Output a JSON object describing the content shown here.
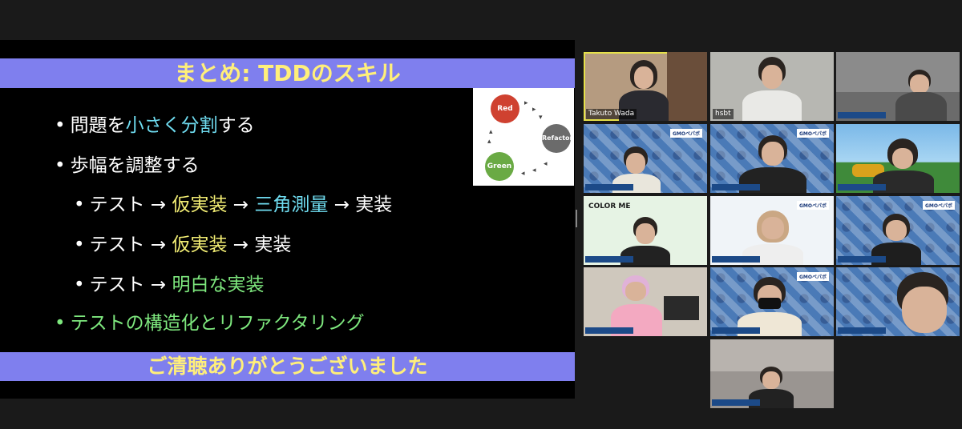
{
  "slide": {
    "title": "まとめ: TDDのスキル",
    "bullets": [
      {
        "parts": [
          "問題を",
          "小さく分割",
          "する"
        ]
      },
      {
        "parts": [
          "歩幅を調整する"
        ]
      },
      {
        "parts": [
          "テスト → ",
          "仮実装",
          " → ",
          "三角測量",
          " → 実装"
        ]
      },
      {
        "parts": [
          "テスト → ",
          "仮実装",
          " → 実装"
        ]
      },
      {
        "parts": [
          "テスト → ",
          "明白な実装"
        ]
      },
      {
        "parts": [
          "テストの構造化とリファクタリング"
        ]
      }
    ],
    "footer": "ご清聴ありがとうございました",
    "cycle": {
      "red": "Red",
      "refactor": "Refactor",
      "green": "Green"
    }
  },
  "participants": [
    {
      "name": "Takuto Wada",
      "active": true
    },
    {
      "name": "hsbt"
    },
    {
      "name": ""
    },
    {
      "name": "",
      "logo": "GMOペパボ"
    },
    {
      "name": "",
      "logo": "GMOペパボ"
    },
    {
      "name": ""
    },
    {
      "name": "",
      "brand": "COLOR ME"
    },
    {
      "name": "",
      "logo": "GMOペパボ"
    },
    {
      "name": "",
      "logo": "GMOペパボ"
    },
    {
      "name": ""
    },
    {
      "name": "",
      "logo": "GMOペパボ"
    },
    {
      "name": ""
    },
    {
      "name": ""
    }
  ],
  "colors": {
    "title_bar": "#7f7fee",
    "title_text": "#ffef7a",
    "accent_cyan": "#6fdcf0",
    "accent_yellow": "#f3ee74",
    "accent_green": "#7ee87e",
    "active_speaker": "#e6e14a"
  }
}
